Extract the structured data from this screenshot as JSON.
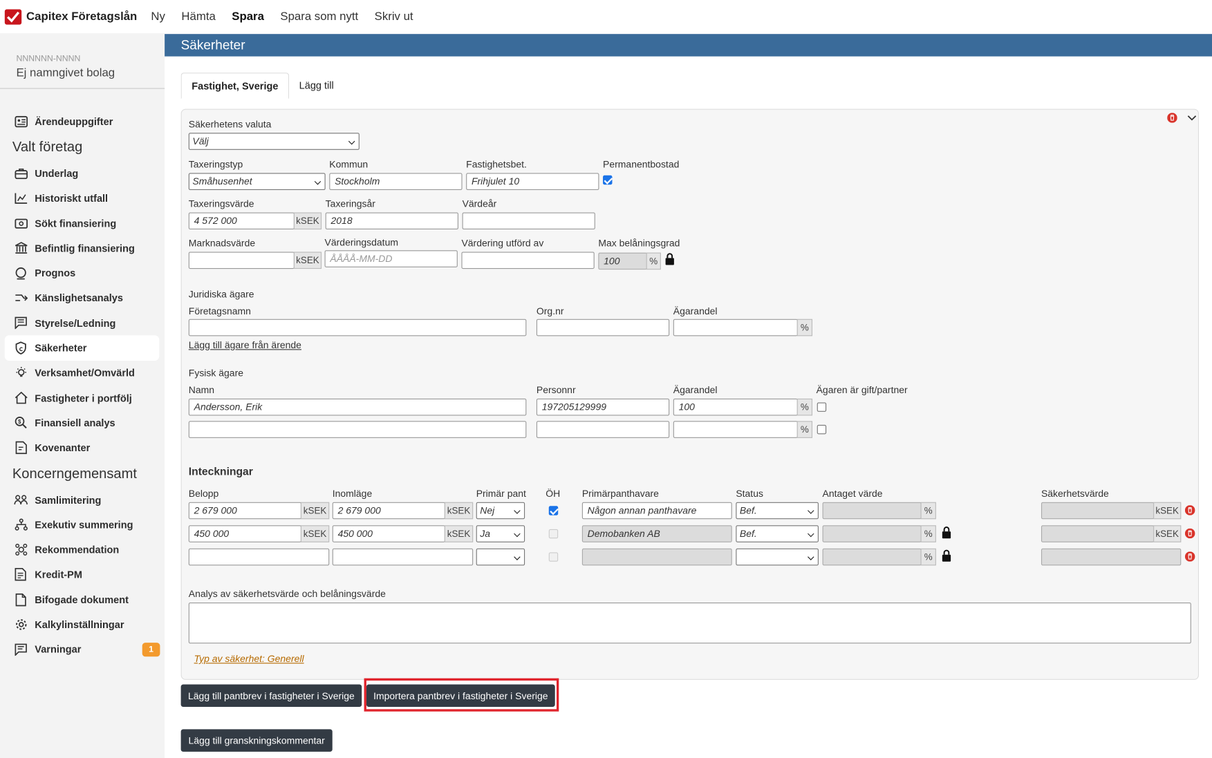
{
  "app": {
    "title": "Capitex Företagslån"
  },
  "topnav": {
    "items": [
      "Ny",
      "Hämta",
      "Spara",
      "Spara som nytt",
      "Skriv ut"
    ]
  },
  "sidebar": {
    "case_id": "NNNNNN-NNNN",
    "company": "Ej namngivet bolag",
    "item_case": "Ärendeuppgifter",
    "heading_company": "Valt företag",
    "items_company": [
      "Underlag",
      "Historiskt utfall",
      "Sökt finansiering",
      "Befintlig finansiering",
      "Prognos",
      "Känslighetsanalys",
      "Styrelse/Ledning",
      "Säkerheter",
      "Verksamhet/Omvärld",
      "Fastigheter i portfölj",
      "Finansiell analys",
      "Kovenanter"
    ],
    "heading_group": "Koncerngemensamt",
    "items_group": [
      "Samlimitering",
      "Exekutiv summering",
      "Rekommendation",
      "Kredit-PM",
      "Bifogade dokument",
      "Kalkylinställningar",
      "Varningar"
    ],
    "warnings_count": "1"
  },
  "page": {
    "title": "Säkerheter"
  },
  "tabs": [
    "Fastighet, Sverige",
    "Lägg till"
  ],
  "form": {
    "currency_label": "Säkerhetens valuta",
    "currency_value": "Välj",
    "taxtype_label": "Taxeringstyp",
    "taxtype_value": "Småhusenhet",
    "kommun_label": "Kommun",
    "kommun_value": "Stockholm",
    "fastbet_label": "Fastighetsbet.",
    "fastbet_value": "Frihjulet 10",
    "permanent_label": "Permanentbostad",
    "taxval_label": "Taxeringsvärde",
    "taxval_value": "4 572 000",
    "taxyear_label": "Taxeringsår",
    "taxyear_value": "2018",
    "valyear_label": "Värdeår",
    "market_label": "Marknadsvärde",
    "valdate_label": "Värderingsdatum",
    "valdate_placeholder": "ÅÅÅÅ-MM-DD",
    "valby_label": "Värdering utförd av",
    "maxltv_label": "Max belåningsgrad",
    "maxltv_value": "100",
    "unit_ksek": "kSEK",
    "unit_pct": "%"
  },
  "legal_owners": {
    "title": "Juridiska ägare",
    "name_label": "Företagsnamn",
    "org_label": "Org.nr",
    "share_label": "Ägarandel",
    "add_link": "Lägg till ägare från ärende"
  },
  "physical_owners": {
    "title": "Fysisk ägare",
    "name_label": "Namn",
    "pnr_label": "Personnr",
    "share_label": "Ägarandel",
    "married_label": "Ägaren är gift/partner",
    "rows": [
      {
        "name": "Andersson, Erik",
        "pnr": "197205129999",
        "share": "100"
      },
      {
        "name": "",
        "pnr": "",
        "share": ""
      }
    ]
  },
  "mortgages": {
    "title": "Inteckningar",
    "headers": [
      "Belopp",
      "Inomläge",
      "Primär pant",
      "ÖH",
      "Primärpanthavare",
      "Status",
      "Antaget värde",
      "Säkerhetsvärde"
    ],
    "rows": [
      {
        "amount": "2 679 000",
        "inom": "2 679 000",
        "primary": "Nej",
        "holder": "Någon annan panthavare",
        "status": "Bef."
      },
      {
        "amount": "450 000",
        "inom": "450 000",
        "primary": "Ja",
        "holder": "Demobanken AB",
        "status": "Bef."
      },
      {
        "amount": "",
        "inom": "",
        "primary": "",
        "holder": "",
        "status": ""
      }
    ]
  },
  "analysis": {
    "label": "Analys av säkerhetsvärde och belåningsvärde",
    "type_link": "Typ av säkerhet: Generell"
  },
  "buttons": {
    "add_pantbrev": "Lägg till pantbrev i fastigheter i Sverige",
    "import_pantbrev": "Importera pantbrev i fastigheter i Sverige",
    "add_comment": "Lägg till granskningskommentar"
  }
}
